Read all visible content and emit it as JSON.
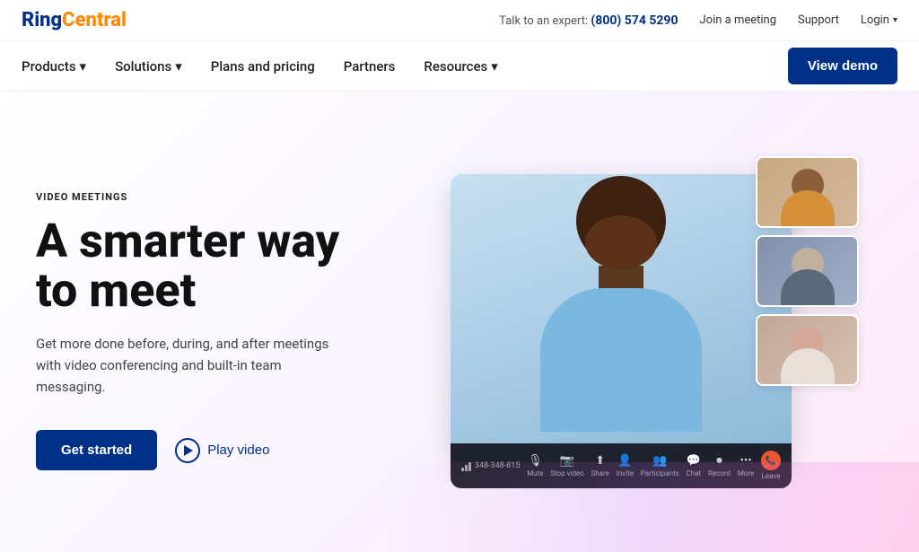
{
  "topbar": {
    "expert_text": "Talk to an expert:",
    "phone": "(800) 574 5290",
    "join_meeting": "Join a meeting",
    "support": "Support",
    "login": "Login"
  },
  "logo": {
    "ring": "Ring",
    "central": "Central"
  },
  "nav": {
    "products": "Products",
    "solutions": "Solutions",
    "plans": "Plans and pricing",
    "partners": "Partners",
    "resources": "Resources",
    "view_demo": "View demo"
  },
  "hero": {
    "tag": "VIDEO MEETINGS",
    "title_line1": "A smarter way",
    "title_line2": "to meet",
    "description": "Get more done before, during, and after meetings with video conferencing and built-in team messaging.",
    "get_started": "Get started",
    "play_video": "Play video"
  },
  "controls": [
    {
      "icon": "🎙",
      "label": "Mute"
    },
    {
      "icon": "📷",
      "label": "Stop video"
    },
    {
      "icon": "🔗",
      "label": "Share"
    },
    {
      "icon": "👤",
      "label": "Invite"
    },
    {
      "icon": "👥",
      "label": "Participants"
    },
    {
      "icon": "💬",
      "label": "Chat"
    },
    {
      "icon": "⏺",
      "label": "Record"
    },
    {
      "icon": "•••",
      "label": "More"
    },
    {
      "icon": "📞",
      "label": "Leave",
      "isEnd": true
    }
  ],
  "call_id": "348-348-815"
}
